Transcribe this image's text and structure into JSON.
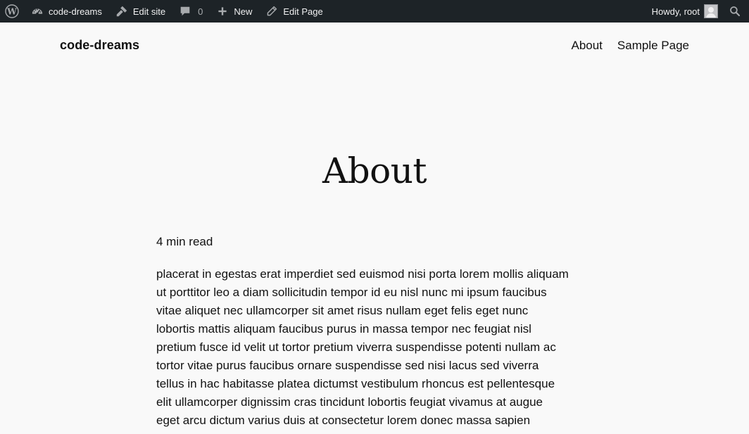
{
  "admin_bar": {
    "site_name": "code-dreams",
    "edit_site_label": "Edit site",
    "comments_count": "0",
    "new_label": "New",
    "edit_page_label": "Edit Page",
    "greeting": "Howdy, root",
    "icons": {
      "logo": "wordpress-logo-icon",
      "dashboard": "dashboard-icon",
      "edit_site": "brush-icon",
      "comments": "comment-bubble-icon",
      "new": "plus-icon",
      "edit_page": "pencil-icon",
      "avatar": "user-avatar-icon",
      "search": "search-icon"
    },
    "colors": {
      "background": "#1d2327",
      "text": "#f0f0f1",
      "icon": "#a7aaad"
    }
  },
  "site_header": {
    "title": "code-dreams",
    "nav": [
      {
        "label": "About"
      },
      {
        "label": "Sample Page"
      }
    ]
  },
  "page": {
    "title": "About",
    "read_time": "4 min read",
    "body_lines": [
      "placerat in egestas erat imperdiet sed euismod nisi porta lorem mollis aliquam",
      "ut porttitor leo a diam sollicitudin tempor id eu nisl nunc mi ipsum faucibus",
      "vitae aliquet nec ullamcorper sit amet risus nullam eget felis eget nunc",
      "lobortis mattis aliquam faucibus purus in massa tempor nec feugiat nisl",
      "pretium fusce id velit ut tortor pretium viverra suspendisse potenti nullam ac",
      "tortor vitae purus faucibus ornare suspendisse sed nisi lacus sed viverra",
      "tellus in hac habitasse platea dictumst vestibulum rhoncus est pellentesque",
      "elit ullamcorper dignissim cras tincidunt lobortis feugiat vivamus at augue",
      "eget arcu dictum varius duis at consectetur lorem donec massa sapien"
    ]
  }
}
